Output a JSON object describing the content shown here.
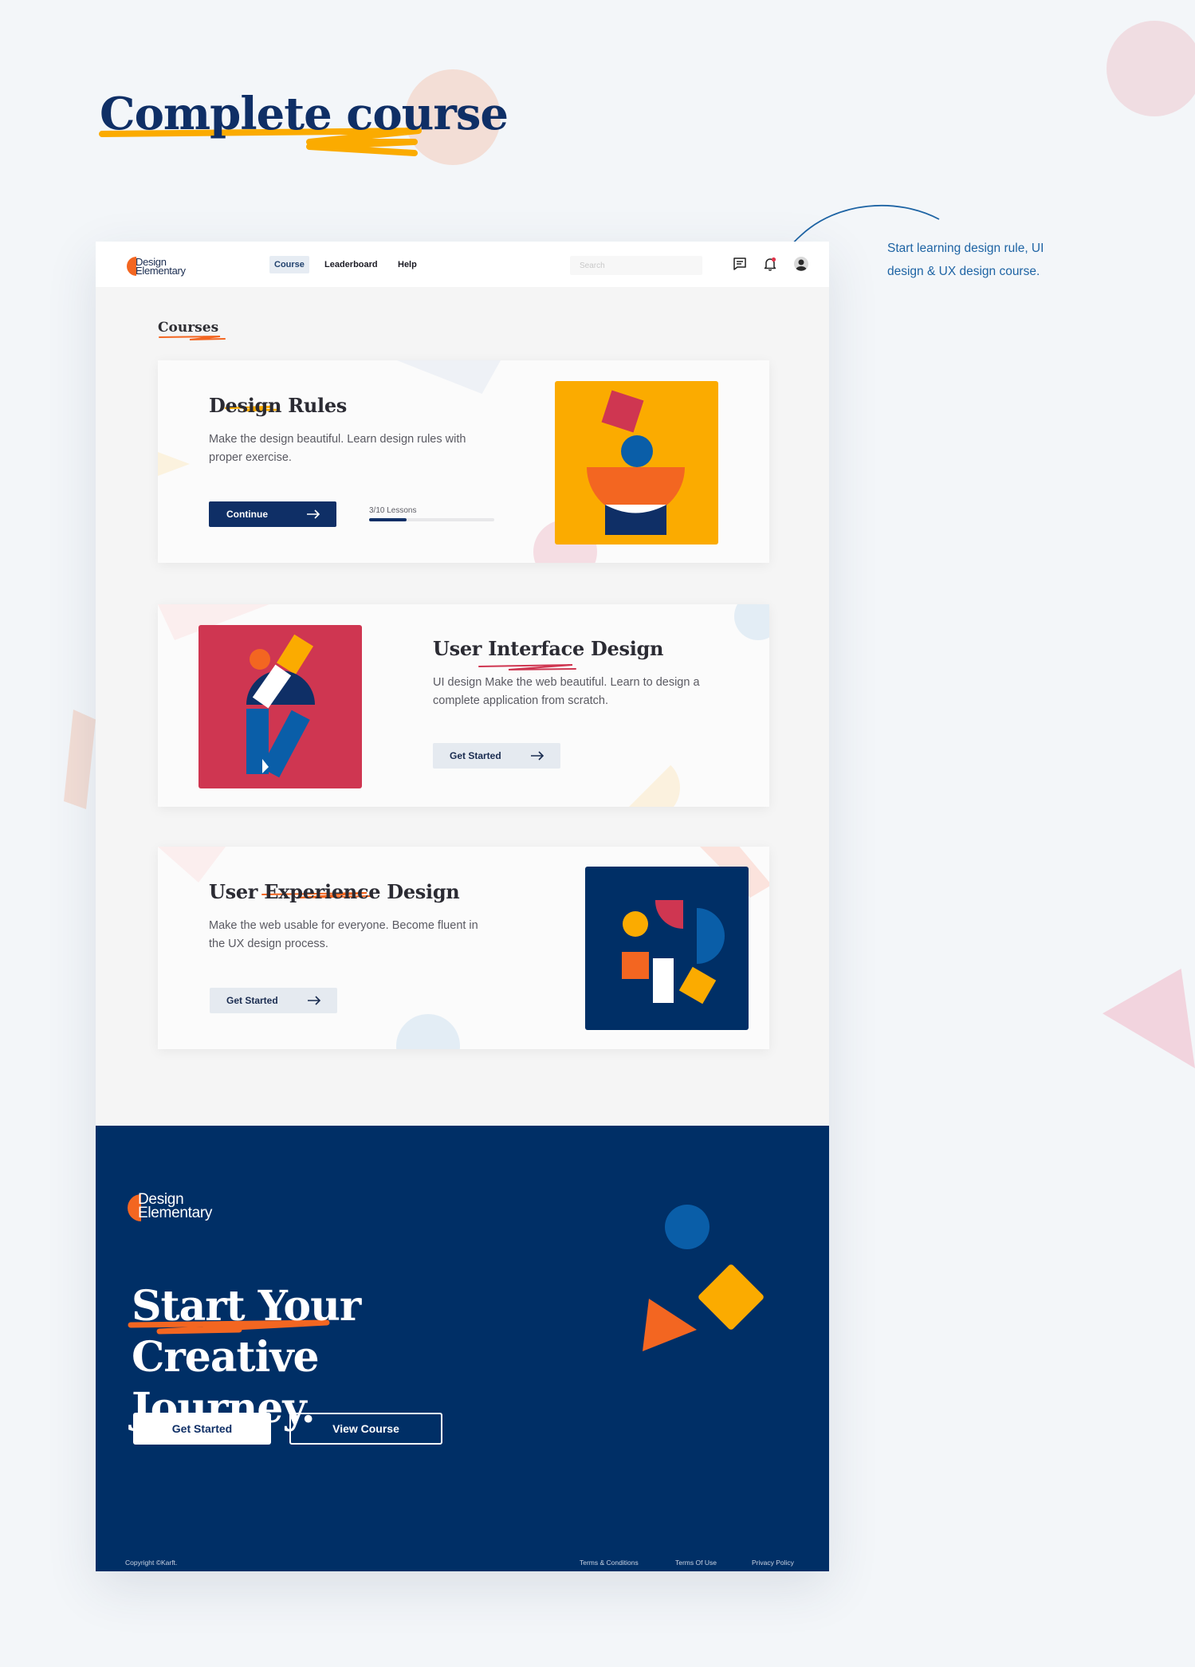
{
  "page": {
    "title": "Complete course",
    "note": "Start learning design rule, UI design & UX design course."
  },
  "brand": {
    "line1": "Design",
    "line2": "Elementary"
  },
  "nav": {
    "items": [
      "Course",
      "Leaderboard",
      "Help"
    ],
    "active": "Course",
    "search_placeholder": "Search",
    "icons": [
      "message-icon",
      "bell-icon",
      "avatar"
    ]
  },
  "main": {
    "section_label": "Courses",
    "courses": [
      {
        "title_pre": "Design ",
        "title_em": "Rules",
        "title_post": "",
        "description": "Make the design beautiful. Learn design rules with proper exercise.",
        "button": "Continue",
        "lessons": "3/10 Lessons",
        "progress": 0.3
      },
      {
        "title_pre": "User ",
        "title_em": "Interface",
        "title_post": " Design",
        "description": "UI design Make the web beautiful. Learn to design a complete application from scratch.",
        "button": "Get Started"
      },
      {
        "title_pre": "User ",
        "title_em": "Experience",
        "title_post": " Design",
        "description": "Make the web usable for everyone. Become fluent in the UX design process.",
        "button": "Get Started"
      }
    ]
  },
  "cta": {
    "title_line1_em": "Start Your",
    "title_line1_rest": " Creative",
    "title_line2": "Journey.",
    "primary_button": "Get Started",
    "secondary_button": "View Course"
  },
  "footer": {
    "copyright": "Copyright ©Karft.",
    "links": [
      "Terms & Conditions",
      "Terms Of Use",
      "Privacy Policy"
    ]
  },
  "colors": {
    "navy": "#0f2f66",
    "footer_bg": "#002f66",
    "accent_yellow": "#fbab00",
    "accent_orange": "#f36621",
    "accent_red": "#cf3651",
    "accent_blue": "#0a5ea8",
    "note_blue": "#1e64a4"
  }
}
